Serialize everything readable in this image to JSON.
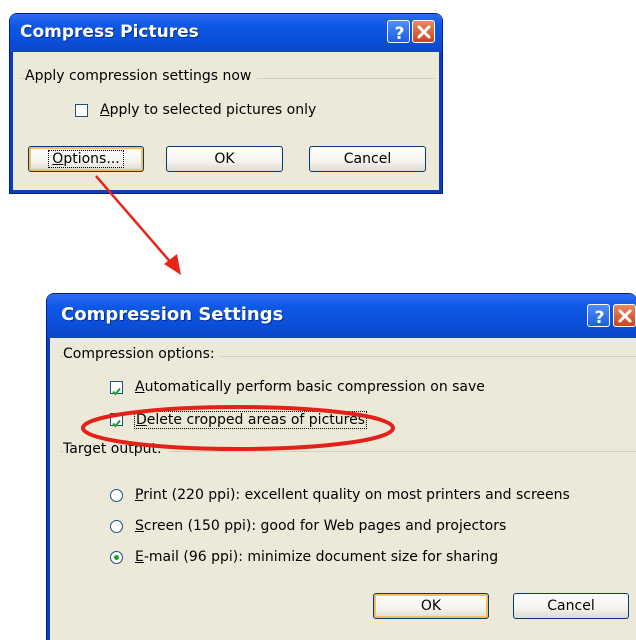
{
  "compress_dialog": {
    "title": "Compress Pictures",
    "group_label": "Apply compression settings now",
    "apply_selected": {
      "label_first": "A",
      "label_rest": "pply to selected pictures only",
      "checked": false
    },
    "buttons": {
      "options_first": "O",
      "options_rest": "ptions...",
      "ok": "OK",
      "cancel": "Cancel"
    },
    "help_icon": "?",
    "close_icon": "close-x"
  },
  "settings_dialog": {
    "title": "Compression Settings",
    "compression_group_label": "Compression options:",
    "auto_compress": {
      "label_first": "A",
      "label_rest": "utomatically perform basic compression on save",
      "checked": true
    },
    "delete_cropped": {
      "label_first": "D",
      "label_rest": "elete cropped areas of pictures",
      "checked": true
    },
    "target_group_label": "Target output:",
    "targets": [
      {
        "first": "P",
        "rest": "rint (220 ppi): excellent quality on most printers and screens",
        "selected": false
      },
      {
        "first": "S",
        "rest": "creen (150 ppi): good for Web pages and projectors",
        "selected": false
      },
      {
        "first": "E",
        "rest": "-mail (96 ppi): minimize document size for sharing",
        "selected": true
      }
    ],
    "buttons": {
      "ok": "OK",
      "cancel": "Cancel"
    },
    "help_icon": "?",
    "close_icon": "close-x"
  },
  "annotation_colors": {
    "arrow": "#e8251a",
    "ellipse": "#e32119"
  }
}
